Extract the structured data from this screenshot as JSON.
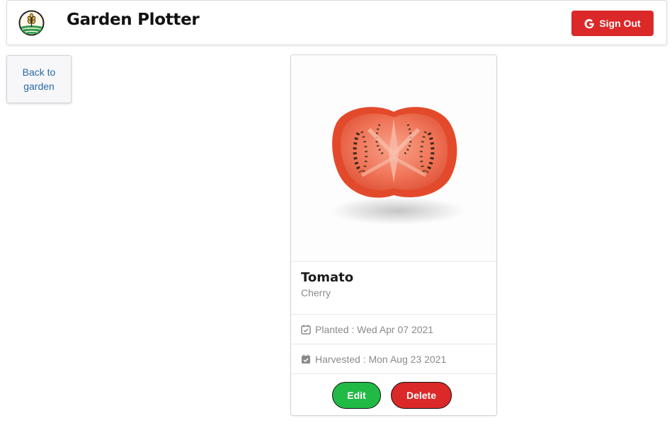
{
  "header": {
    "title": "Garden Plotter",
    "sign_out_label": "Sign Out",
    "logo_icon": "wheat-field-logo-icon",
    "sign_out_icon": "google-icon"
  },
  "nav": {
    "back_label": "Back to garden"
  },
  "plant": {
    "name": "Tomato",
    "variety": "Cherry",
    "image_icon": "tomato-slice-image",
    "planted": "Planted : Wed Apr 07 2021",
    "harvested": "Harvested : Mon Aug 23 2021",
    "planted_icon": "calendar-check-icon",
    "harvested_icon": "calendar-check-icon"
  },
  "actions": {
    "edit_label": "Edit",
    "delete_label": "Delete"
  },
  "colors": {
    "sign_out": "#db2828",
    "edit": "#21ba45",
    "delete": "#db2828",
    "link": "#2a6aa3"
  }
}
